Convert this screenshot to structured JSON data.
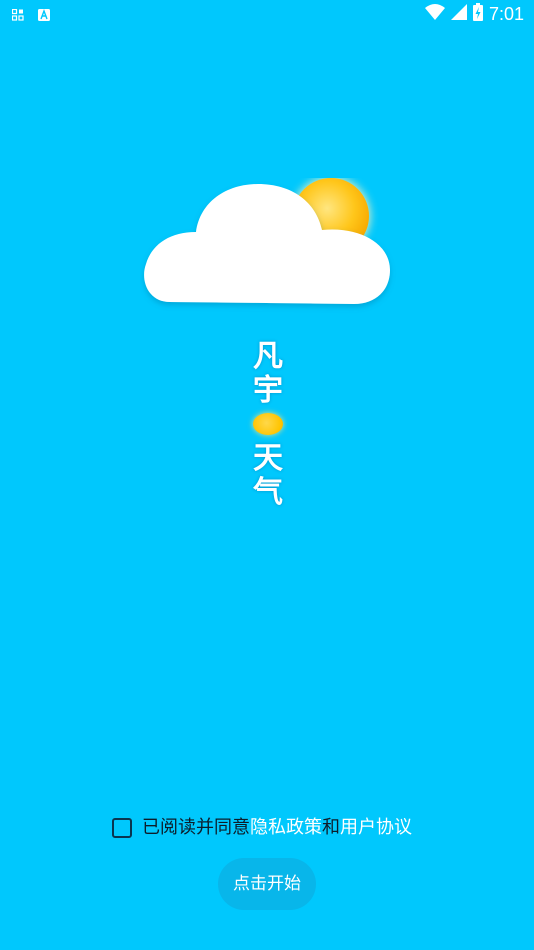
{
  "status_bar": {
    "time": "7:01",
    "icons": [
      "notification-app-icon",
      "notification-a-icon",
      "wifi-icon",
      "cell-signal-icon",
      "battery-charging-icon"
    ]
  },
  "app": {
    "title_chars": [
      "凡",
      "宇",
      "天",
      "气"
    ],
    "logo": "cloud-sun-icon"
  },
  "agreement": {
    "prefix": "已阅读并同意",
    "privacy_link": "隐私政策",
    "conjunction": "和",
    "user_link": "用户协议"
  },
  "start_button": {
    "label": "点击开始"
  },
  "colors": {
    "background": "#00c8fd",
    "button": "#08b6ea",
    "sun": "#ffc400",
    "link": "#ffffff",
    "text": "#0d1d2a"
  }
}
